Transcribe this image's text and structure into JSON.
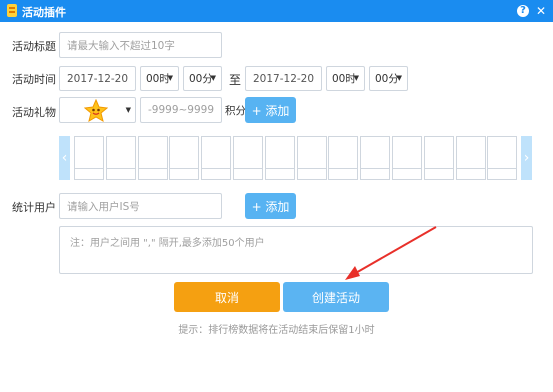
{
  "window": {
    "title": "活动插件",
    "help": "?",
    "close": "✕"
  },
  "form": {
    "name": {
      "label": "活动标题",
      "placeholder": "请最大输入不超过10字"
    },
    "time": {
      "label": "活动时间",
      "start_date": "2017-12-20",
      "start_hour": "00时",
      "start_min": "00分",
      "separator": "至",
      "end_date": "2017-12-20",
      "end_hour": "00时",
      "end_min": "00分"
    },
    "gift": {
      "label": "活动礼物",
      "range_placeholder": "-9999~9999",
      "unit": "积分",
      "add": "+ 添加"
    },
    "users": {
      "label": "统计用户",
      "placeholder": "请输入用户IS号",
      "add": "+ 添加",
      "note": "注：用户之间用 \",\" 隔开,最多添加50个用户"
    }
  },
  "actions": {
    "cancel": "取消",
    "create": "创建活动"
  },
  "tip": "提示：排行榜数据将在活动结束后保留1小时",
  "colors": {
    "titlebar": "#1a8cf0",
    "primary": "#57b3f2",
    "cancel": "#f5a011",
    "annotation": "#e8302a"
  },
  "icons": {
    "logo": "gift-logo-icon",
    "gift": "star-gift-icon",
    "annotation": "red-arrow-icon"
  }
}
